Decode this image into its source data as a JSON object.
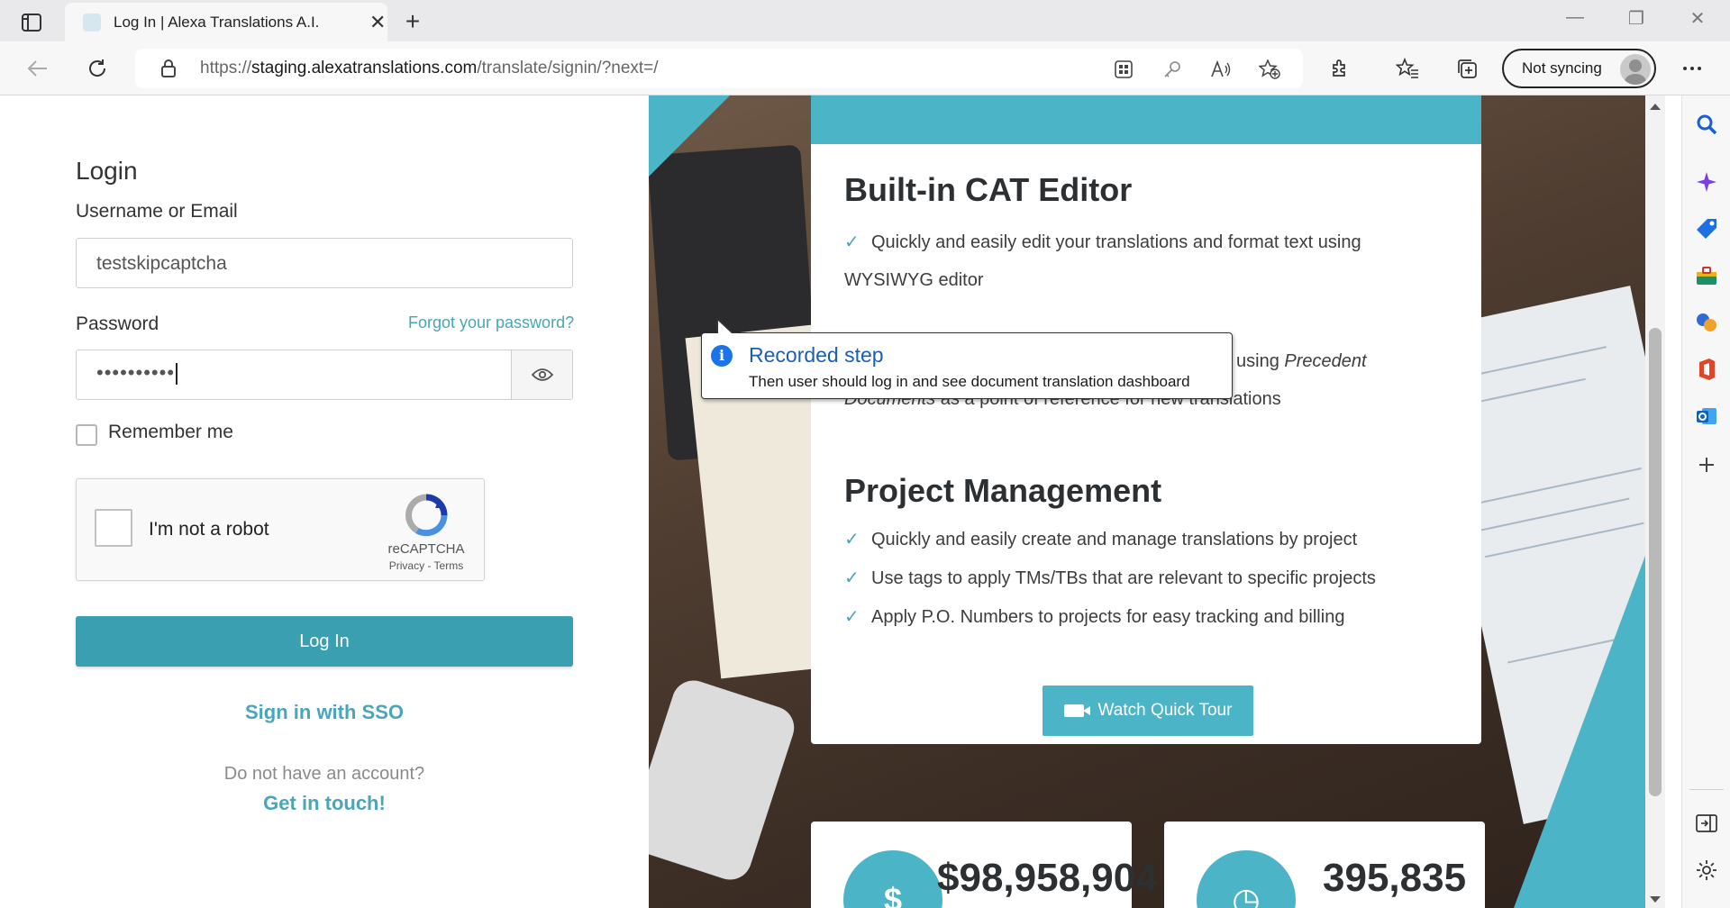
{
  "browser": {
    "tab_title": "Log In | Alexa Translations A.I.",
    "url_prefix": "https://",
    "url_host": "staging.alexatranslations.com",
    "url_path": "/translate/signin/?next=/",
    "sync_label": "Not syncing"
  },
  "login": {
    "title": "Login",
    "username_label": "Username or Email",
    "username_value": "testskipcaptcha",
    "password_label": "Password",
    "forgot_link": "Forgot your password?",
    "password_mask": "••••••••••",
    "remember_label": "Remember me",
    "captcha_text": "I'm not a robot",
    "captcha_brand": "reCAPTCHA",
    "captcha_links": "Privacy - Terms",
    "login_button": "Log In",
    "sso_link": "Sign in with SSO",
    "no_account": "Do not have an account?",
    "get_in_touch": "Get in touch!"
  },
  "features": {
    "cat_heading": "Built-in CAT Editor",
    "cat_item_1": "Quickly and easily edit your translations and format text using WYSIWYG editor",
    "cat_item_3_start": "using ",
    "cat_item_3_em1": "Precedent",
    "cat_item_3_em2": "Documents",
    "cat_item_3_end": " as a point of reference for new translations",
    "pm_heading": "Project Management",
    "pm_items": [
      "Quickly and easily create and manage translations by project",
      "Use tags to apply TMs/TBs that are relevant to specific projects",
      "Apply P.O. Numbers to projects for easy tracking and billing"
    ],
    "tour_button": "Watch Quick Tour"
  },
  "stats": [
    {
      "icon": "dollar-icon",
      "symbol": "$",
      "value": "$98,958,904"
    },
    {
      "icon": "clock-icon",
      "symbol": "◷",
      "value": "395,835"
    }
  ],
  "callout": {
    "title": "Recorded step",
    "text": "Then user should log in and see document translation dashboard"
  },
  "colors": {
    "accent": "#49a6b8",
    "button": "#3a9fb0",
    "teal": "#4bb5c7",
    "callout_title": "#1a5fb4"
  }
}
